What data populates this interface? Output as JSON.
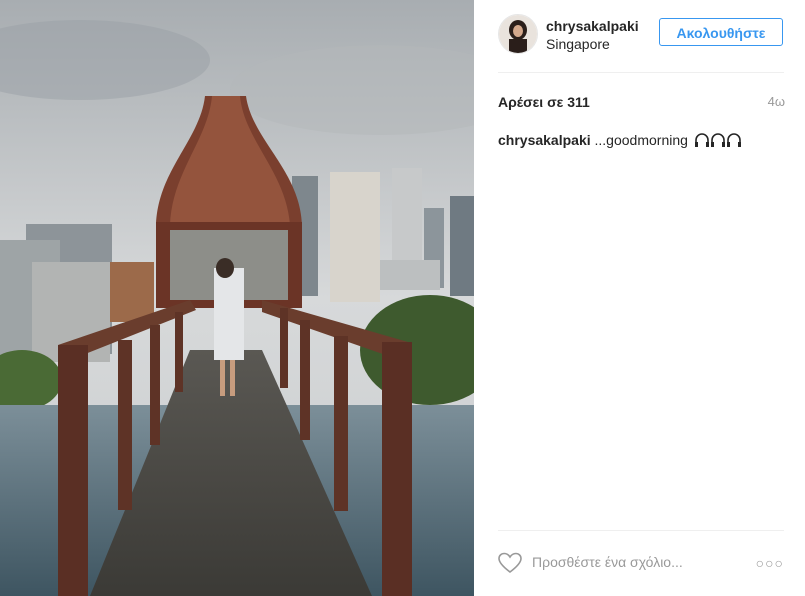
{
  "post": {
    "username": "chrysakalpaki",
    "location": "Singapore",
    "follow_label": "Ακολουθήστε",
    "likes_text": "Αρέσει σε 311",
    "age": "4ω",
    "caption": {
      "username": "chrysakalpaki",
      "text": "...goodmorning",
      "emoji_icon": "headphones-icon"
    },
    "comment_placeholder": "Προσθέστε ένα σχόλιο...",
    "more_label": "○○○"
  },
  "colors": {
    "accent": "#3897f0",
    "text": "#262626",
    "muted": "#999999",
    "divider": "#efefef"
  }
}
